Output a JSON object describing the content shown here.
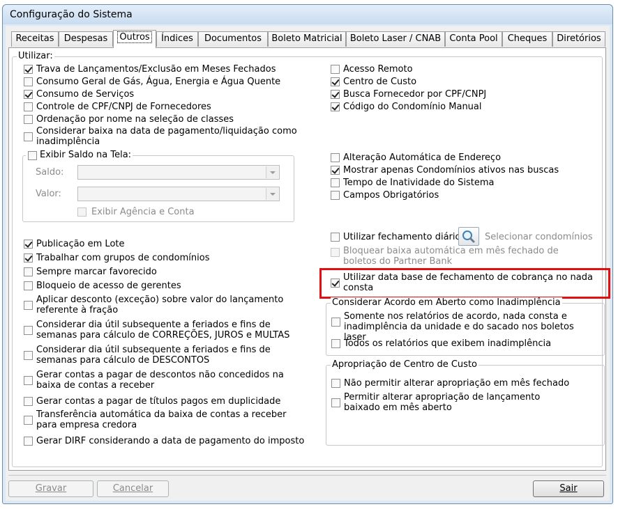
{
  "window": {
    "title": "Configuração do Sistema"
  },
  "tabs": [
    {
      "label": "Receitas"
    },
    {
      "label": "Despesas"
    },
    {
      "label": "Outros"
    },
    {
      "label": "Índices"
    },
    {
      "label": "Documentos"
    },
    {
      "label": "Boleto Matricial"
    },
    {
      "label": "Boleto Laser / CNAB"
    },
    {
      "label": "Conta Pool"
    },
    {
      "label": "Cheques"
    },
    {
      "label": "Diretórios"
    }
  ],
  "utilizar": {
    "title": "Utilizar:",
    "left": [
      {
        "label": "Trava de Lançamentos/Exclusão em Meses Fechados",
        "checked": true
      },
      {
        "label": "Consumo Geral de Gás, Água, Energia e Água Quente",
        "checked": false
      },
      {
        "label": "Consumo de Serviços",
        "checked": true
      },
      {
        "label": "Controle de CPF/CNPJ de Fornecedores",
        "checked": false
      },
      {
        "label": "Ordenação por nome na seleção de classes",
        "checked": false
      },
      {
        "label": "Considerar baixa na data de pagamento/liquidação como inadimplência",
        "checked": false
      }
    ],
    "right": [
      {
        "label": "Acesso Remoto",
        "checked": false
      },
      {
        "label": "Centro de Custo",
        "checked": true
      },
      {
        "label": "Busca Fornecedor por CPF/CNPJ",
        "checked": true
      },
      {
        "label": "Código do Condomínio Manual",
        "checked": true
      }
    ],
    "saldo_group": {
      "title": "Exibir Saldo na Tela:",
      "checked": false,
      "saldo_label": "Saldo:",
      "valor_label": "Valor:",
      "agencia_label": "Exibir Agência e Conta"
    },
    "right2": [
      {
        "label": "Alteração Automática de Endereço",
        "checked": false
      },
      {
        "label": "Mostrar apenas Condomínios ativos nas buscas",
        "checked": true
      },
      {
        "label": "Tempo de Inatividade do Sistema",
        "checked": false
      },
      {
        "label": "Campos Obrigatórios",
        "checked": false
      }
    ],
    "left2": [
      {
        "label": "Publicação em Lote",
        "checked": true
      },
      {
        "label": "Trabalhar com grupos de condomínios",
        "checked": true
      },
      {
        "label": "Sempre marcar favorecido",
        "checked": false
      },
      {
        "label": "Bloqueio de acesso de gerentes",
        "checked": false
      },
      {
        "label": "Aplicar desconto (exceção) sobre valor do lançamento referente à fração",
        "checked": false
      },
      {
        "label": "Considerar dia útil subsequente a feriados e fins de semanas para cálculo de CORREÇÕES, JUROS e MULTAS",
        "checked": false
      },
      {
        "label": "Considerar dia útil subsequente a feriados e fins de semanas para cálculo de DESCONTOS",
        "checked": false
      },
      {
        "label": "Gerar contas a pagar de descontos não concedidos na baixa de contas a receber",
        "checked": false
      },
      {
        "label": "Gerar contas a pagar de títulos pagos em duplicidade",
        "checked": false
      },
      {
        "label": "Transferência automática da baixa de contas a receber para empresa credora",
        "checked": false
      },
      {
        "label": "Gerar DIRF considerando a data de pagamento do imposto",
        "checked": false
      }
    ],
    "fechamento": {
      "label": "Utilizar fechamento diário",
      "checked": false,
      "selecionar_label": "Selecionar condomínios"
    },
    "bloquear": {
      "label": "Bloquear baixa automática em mês fechado de boletos do Partner Bank",
      "checked": false
    },
    "data_base": {
      "label": "Utilizar data base de fechamento de cobrança no nada consta",
      "checked": true
    },
    "acordo_group": {
      "title": "Considerar Acordo em Aberto como Inadimplência",
      "items": [
        {
          "label": "Somente nos relatórios de acordo, nada consta e inadimplência da unidade e do sacado nos boletos laser",
          "checked": false
        },
        {
          "label": "Todos os relatórios que exibem inadimplência",
          "checked": false
        }
      ]
    },
    "centro_group": {
      "title": "Apropriação de Centro de Custo",
      "items": [
        {
          "label": "Não permitir alterar apropriação em mês fechado",
          "checked": false
        },
        {
          "label": "Permitir alterar apropriação de lançamento baixado em mês aberto",
          "checked": false
        }
      ]
    }
  },
  "buttons": {
    "gravar": "Gravar",
    "cancelar": "Cancelar",
    "sair": "Sair"
  },
  "colors": {
    "highlight": "#e01010"
  }
}
